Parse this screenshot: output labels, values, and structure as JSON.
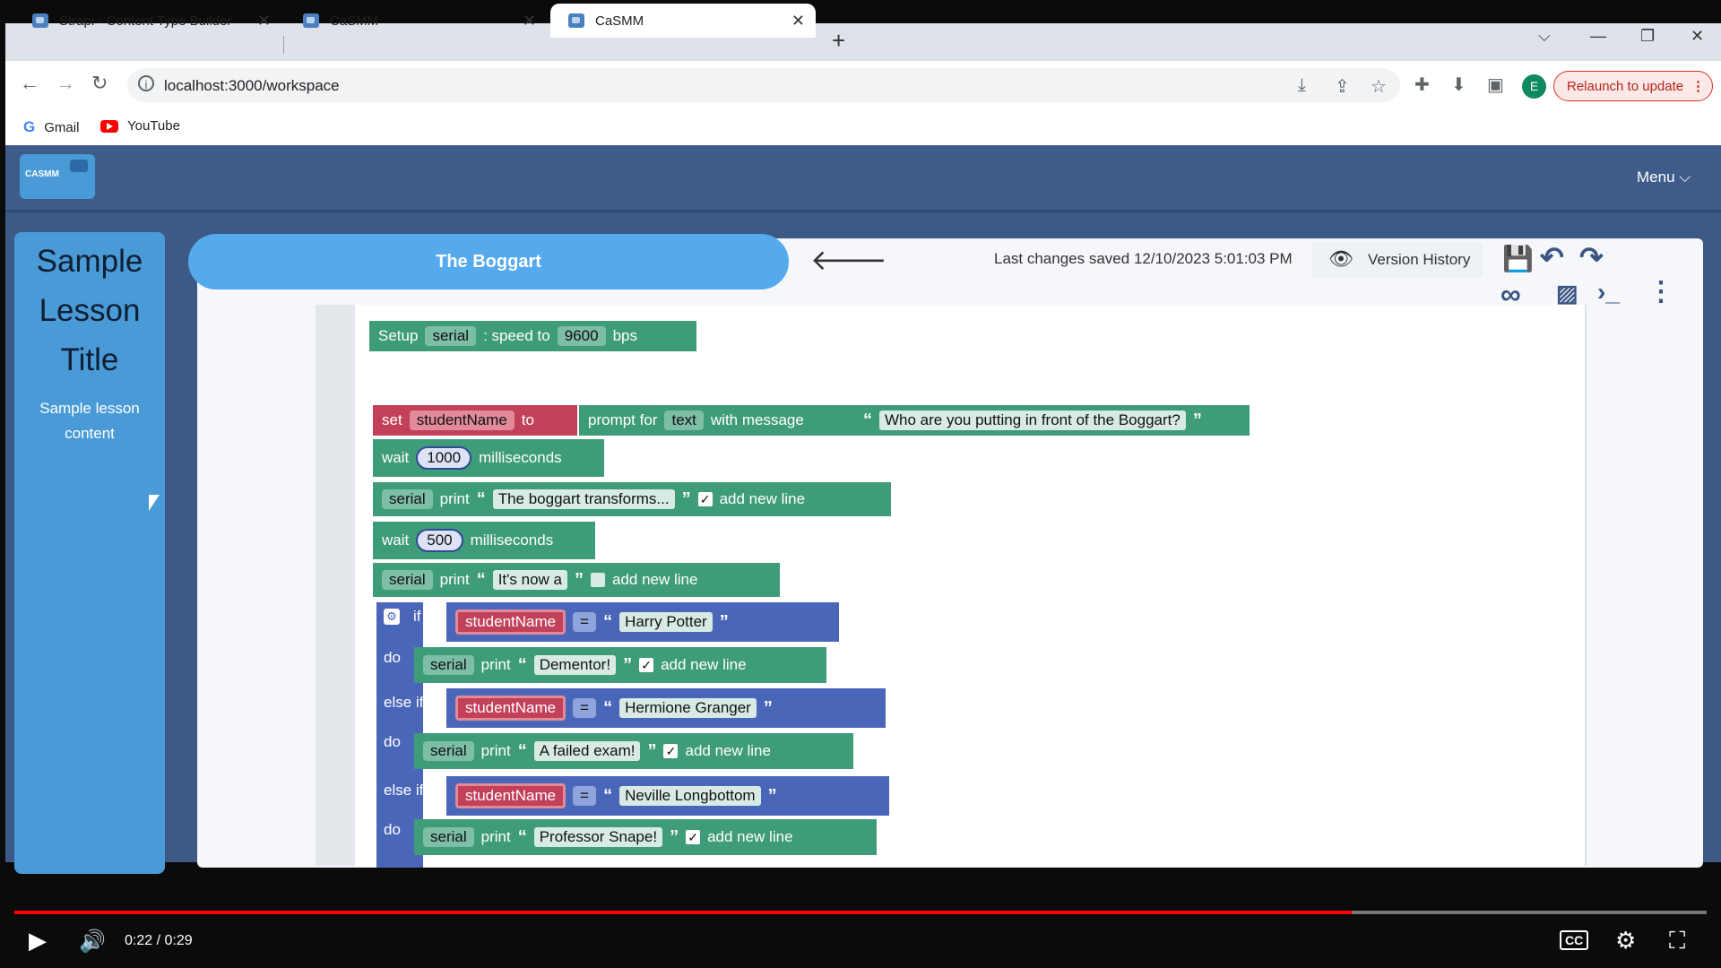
{
  "browser": {
    "tabs": [
      {
        "label": "Strapi - Content Type Builder",
        "close": "✕"
      },
      {
        "label": "CaSMM",
        "close": "✕"
      },
      {
        "label": "CaSMM",
        "close": "✕"
      }
    ],
    "new_tab": "+",
    "url": "localhost:3000/workspace",
    "relaunch": "Relaunch to update",
    "profile_initial": "E",
    "bookmarks": [
      "Gmail",
      "YouTube"
    ]
  },
  "app": {
    "logo_text": "CASMM",
    "menu_label": "Menu ⌵",
    "lesson": {
      "title_lines": [
        "Sample",
        "Lesson",
        "Title"
      ],
      "content_lines": [
        "Sample lesson",
        "content"
      ]
    },
    "workspace": {
      "activity_title": "The Boggart",
      "last_saved": "Last changes saved 12/10/2023 5:01:03 PM",
      "version_history": "Version History"
    },
    "blocks": {
      "setup": {
        "kw1": "Setup",
        "port": "serial",
        "kw2": ": speed to",
        "baud": "9600",
        "kw3": "bps"
      },
      "set": {
        "kw1": "set",
        "var": "studentName",
        "kw2": "to",
        "kw3": "prompt for",
        "type": "text",
        "kw4": "with message",
        "msg": "Who are you putting in front of the Boggart?"
      },
      "wait1": {
        "kw1": "wait",
        "value": "1000",
        "kw2": "milliseconds"
      },
      "print1": {
        "port": "serial",
        "kw": "print",
        "text": "The boggart transforms...",
        "newline": "add new line"
      },
      "wait2": {
        "kw1": "wait",
        "value": "500",
        "kw2": "milliseconds"
      },
      "print2": {
        "port": "serial",
        "kw": "print",
        "text": "It's now a",
        "newline": "add new line"
      },
      "if_kw": "if",
      "do_kw": "do",
      "else_if_kw": "else if",
      "cond1": {
        "var": "studentName",
        "op": "=",
        "value": "Harry Potter"
      },
      "do1": {
        "port": "serial",
        "kw": "print",
        "text": "Dementor!",
        "newline": "add new line"
      },
      "cond2": {
        "var": "studentName",
        "op": "=",
        "value": "Hermione Granger"
      },
      "do2": {
        "port": "serial",
        "kw": "print",
        "text": "A failed exam!",
        "newline": "add new line"
      },
      "cond3": {
        "var": "studentName",
        "op": "=",
        "value": "Neville Longbottom"
      },
      "do3": {
        "port": "serial",
        "kw": "print",
        "text": "Professor Snape!",
        "newline": "add new line"
      }
    }
  },
  "video": {
    "time": "0:22 / 0:29",
    "progress": 0.79
  }
}
